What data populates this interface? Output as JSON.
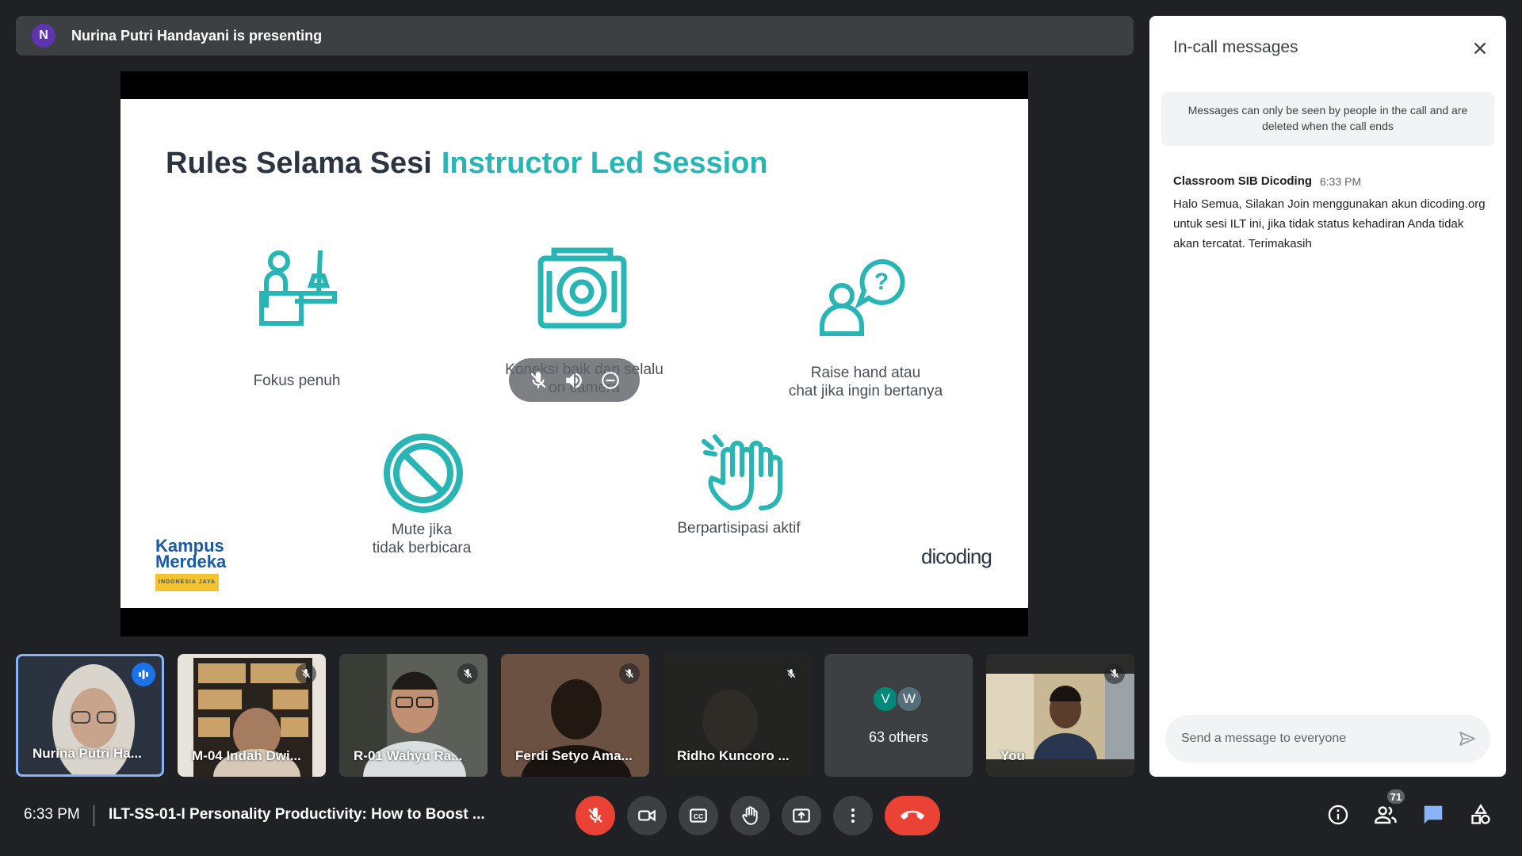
{
  "presenting": {
    "initial": "N",
    "text": "Nurina Putri Handayani is presenting"
  },
  "slide": {
    "title_main": "Rules Selama Sesi",
    "title_accent": "Instructor Led Session",
    "items": [
      {
        "label": "Fokus penuh",
        "icon": "person-at-desk-icon"
      },
      {
        "label": "Koneksi baik dan selalu\non camera",
        "icon": "camera-icon"
      },
      {
        "label": "Raise hand atau\nchat jika ingin bertanya",
        "icon": "person-question-icon"
      },
      {
        "label": "Mute jika\ntidak berbicara",
        "icon": "prohibited-icon"
      },
      {
        "label": "Berpartisipasi aktif",
        "icon": "raised-hands-icon"
      }
    ],
    "logo_left_line1": "Kampus",
    "logo_left_line2": "Merdeka",
    "logo_left_sub": "INDONESIA JAYA",
    "logo_right": "dicoding",
    "accent_color": "#2ab5b5"
  },
  "participants": [
    {
      "name": "Nurina Putri Ha...",
      "muted": false,
      "speaking": true
    },
    {
      "name": "M-04 Indah Dwi...",
      "muted": true
    },
    {
      "name": "R-01 Wahyu Ra...",
      "muted": true
    },
    {
      "name": "Ferdi Setyo Ama...",
      "muted": true
    },
    {
      "name": "Ridho Kuncoro ...",
      "muted": true
    },
    {
      "name": "You",
      "muted": true
    }
  ],
  "others": {
    "avatars": [
      {
        "initial": "V",
        "color": "#00897b"
      },
      {
        "initial": "W",
        "color": "#546e7a"
      }
    ],
    "label": "63 others"
  },
  "bottom": {
    "time": "6:33 PM",
    "meeting_title": "ILT-SS-01-I Personality Productivity: How to Boost ...",
    "people_count": "71"
  },
  "chat": {
    "title": "In-call messages",
    "notice": "Messages can only be seen by people in the call and are deleted when the call ends",
    "messages": [
      {
        "sender": "Classroom SIB Dicoding",
        "time": "6:33 PM",
        "text": "Halo Semua, Silakan Join menggunakan akun dicoding.org untuk sesi ILT ini, jika tidak status kehadiran Anda tidak akan tercatat. Terimakasih"
      }
    ],
    "input_placeholder": "Send a message to everyone"
  }
}
